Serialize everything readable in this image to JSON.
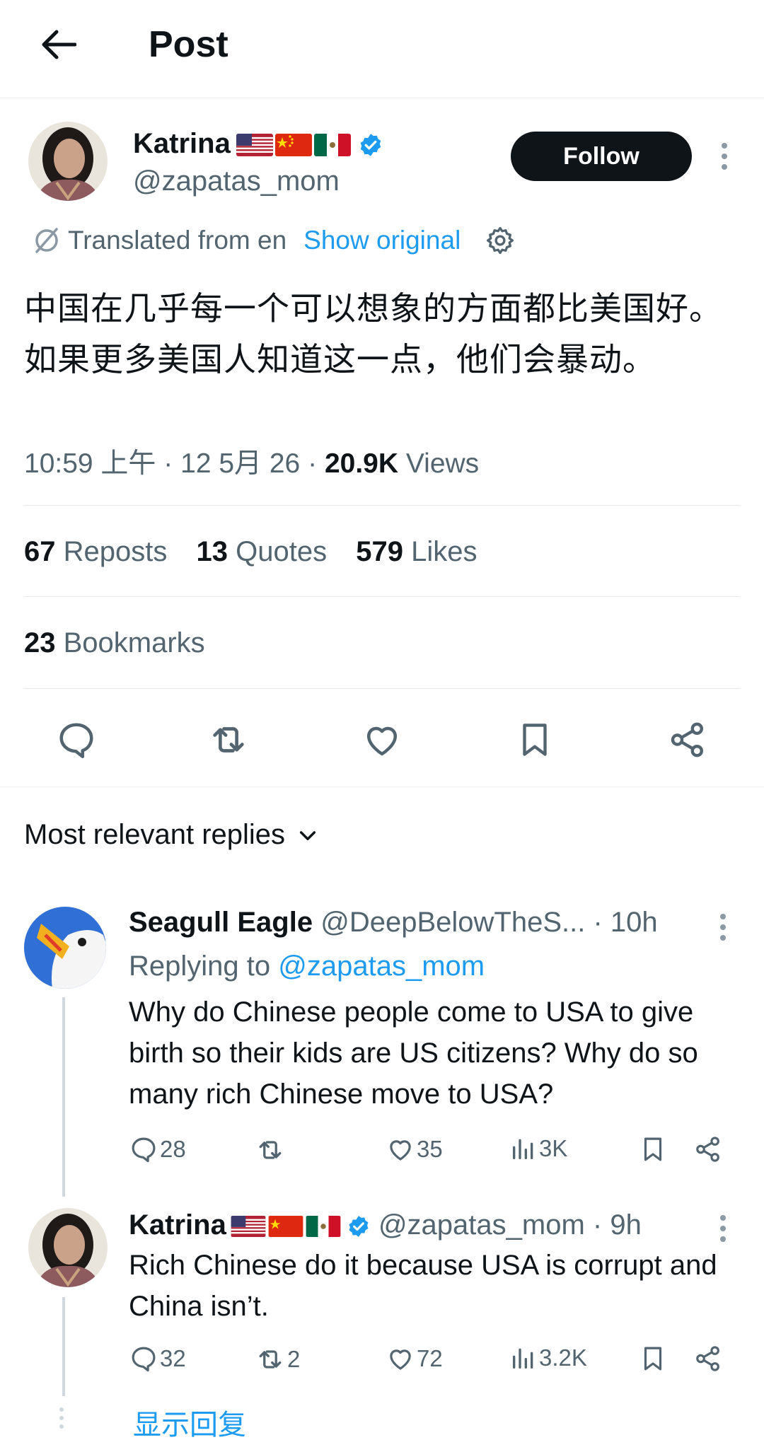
{
  "header": {
    "title": "Post"
  },
  "post": {
    "author": {
      "name": "Katrina",
      "handle": "@zapatas_mom"
    },
    "follow_label": "Follow",
    "translation": {
      "label": "Translated from en",
      "show_original": "Show original"
    },
    "text": "中国在几乎每一个可以想象的方面都比美国好。如果更多美国人知道这一点，他们会暴动。",
    "meta": {
      "time": "10:59 上午",
      "date": "12 5月 26",
      "views_count": "20.9K",
      "views_label": "Views",
      "sep": "·"
    },
    "stats": {
      "reposts": {
        "count": "67",
        "label": "Reposts"
      },
      "quotes": {
        "count": "13",
        "label": "Quotes"
      },
      "likes": {
        "count": "579",
        "label": "Likes"
      },
      "bookmarks": {
        "count": "23",
        "label": "Bookmarks"
      }
    }
  },
  "replies_header": {
    "label": "Most relevant replies"
  },
  "replies": [
    {
      "name": "Seagull Eagle",
      "handle": "@DeepBelowTheS...",
      "time": "· 10h",
      "replying_prefix": "Replying to",
      "replying_to": "@zapatas_mom",
      "text": "Why do Chinese people come to USA to give birth so their kids are US citizens? Why do so many rich Chinese move to USA?",
      "replies": "28",
      "reposts": "",
      "likes": "35",
      "views": "3K"
    },
    {
      "name": "Katrina",
      "handle": "@zapatas_mom",
      "time": "· 9h",
      "text": "Rich Chinese do it because USA is corrupt and China isn’t.",
      "replies": "32",
      "reposts": "2",
      "likes": "72",
      "views": "3.2K"
    }
  ],
  "show_replies": {
    "label": "显示回复"
  },
  "colors": {
    "accent": "#1d9bf0",
    "text": "#0f1419",
    "muted": "#536471",
    "follow_bg": "#0f1419"
  },
  "icons": [
    "back-arrow-icon",
    "verified-badge-icon",
    "translate-icon",
    "settings-gear-icon",
    "reply-icon",
    "repost-icon",
    "like-icon",
    "bookmark-icon",
    "share-icon",
    "views-icon",
    "more-icon",
    "chevron-down-icon"
  ]
}
